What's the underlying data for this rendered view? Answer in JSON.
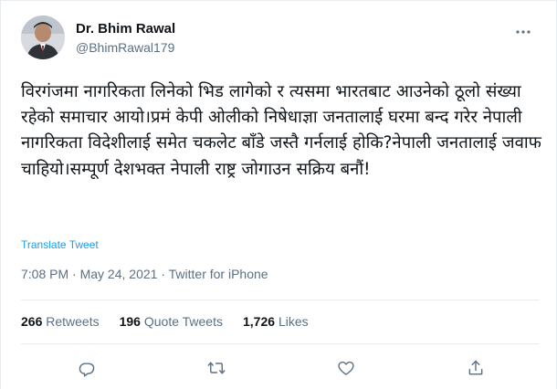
{
  "author": {
    "display_name": "Dr. Bhim Rawal",
    "handle": "@BhimRawal179"
  },
  "tweet": {
    "text": "विरगंजमा नागरिकता लिनेको भिड लागेको र त्यसमा भारतबाट आउनेको ठूलो संख्या रहेको समाचार आयो।प्रमं केपी ओलीको निषेधाज्ञा जनतालाई घरमा बन्द गरेर नेपाली नागरिकता विदेशीलाई समेत चकलेट बाँडे जस्तै गर्नलाई होकि?नेपाली जनतालाई जवाफ चाहियो।सम्पूर्ण देशभक्त नेपाली राष्ट्र जोगाउन सक्रिय बनौं!",
    "translate_label": "Translate Tweet",
    "time": "7:08 PM",
    "separator": " · ",
    "date": "May 24, 2021",
    "source": "Twitter for iPhone"
  },
  "stats": {
    "retweets_count": "266",
    "retweets_label": "Retweets",
    "quotes_count": "196",
    "quotes_label": "Quote Tweets",
    "likes_count": "1,726",
    "likes_label": "Likes"
  },
  "icons": {
    "more": "more-dots-icon",
    "reply": "reply-icon",
    "retweet": "retweet-icon",
    "like": "like-icon",
    "share": "share-icon"
  },
  "colors": {
    "text": "#0f1419",
    "secondary": "#5b7083",
    "link": "#1d9bf0",
    "divider": "#e6ecf0"
  }
}
